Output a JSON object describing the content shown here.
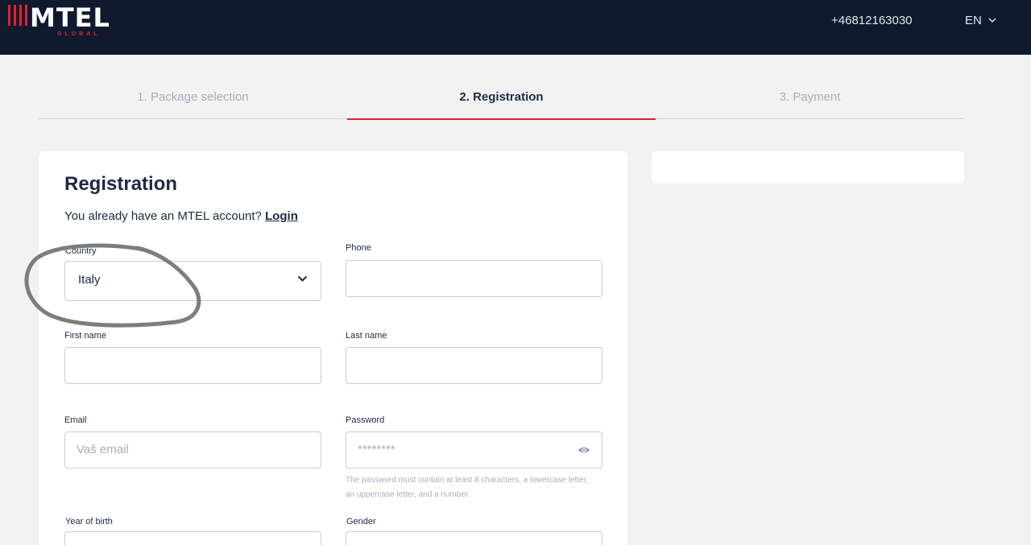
{
  "header": {
    "logo_text": "MTEL",
    "logo_subtext": "GLOBAL",
    "phone": "+46812163030",
    "language": "EN"
  },
  "steps": [
    {
      "label": "1. Package selection",
      "active": false
    },
    {
      "label": "2. Registration",
      "active": true
    },
    {
      "label": "3. Payment",
      "active": false
    }
  ],
  "form": {
    "title": "Registration",
    "login_prompt": "You already have an MTEL account?",
    "login_link": "Login",
    "country": {
      "label": "Country",
      "value": "Italy"
    },
    "phone": {
      "label": "Phone",
      "value": ""
    },
    "first_name": {
      "label": "First name",
      "value": ""
    },
    "last_name": {
      "label": "Last name",
      "value": ""
    },
    "email": {
      "label": "Email",
      "placeholder": "Vaš email"
    },
    "password": {
      "label": "Password",
      "placeholder": "********",
      "hint_line1": "The password must contain at least 8 characters, a lowercase letter,",
      "hint_line2": "an uppercase letter, and a number."
    },
    "year_of_birth": {
      "label": "Year of birth"
    },
    "gender": {
      "label": "Gender"
    }
  },
  "colors": {
    "header_bg": "#0f1a2e",
    "accent_red": "#d8232a",
    "page_bg": "#f2f2f2"
  },
  "icons": [
    "chevron-down-icon",
    "eye-icon"
  ]
}
